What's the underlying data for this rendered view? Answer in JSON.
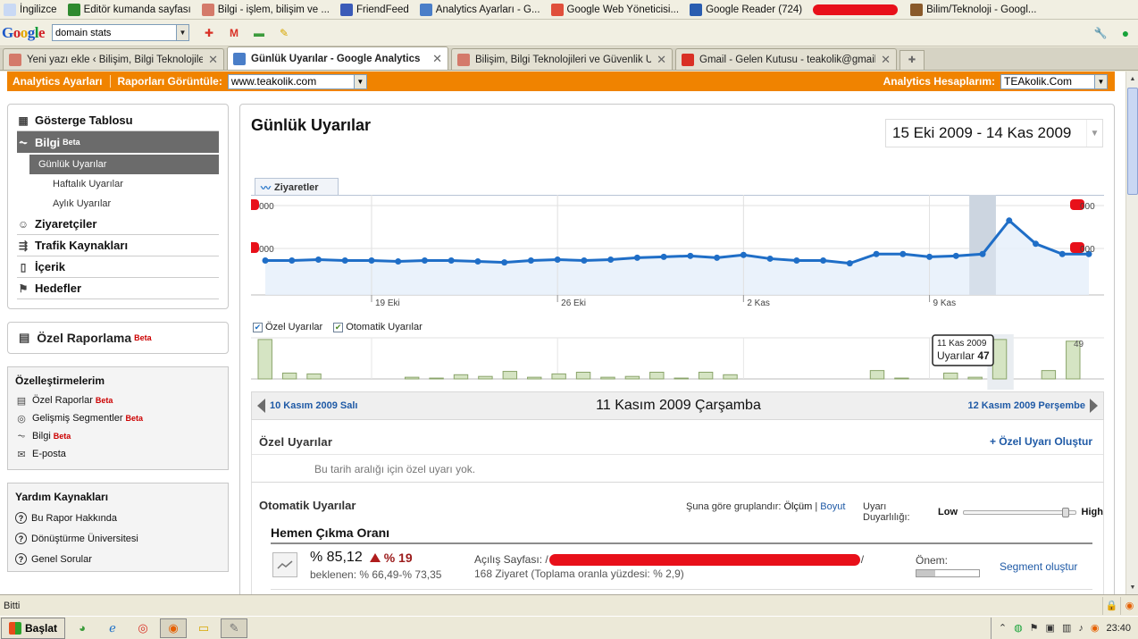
{
  "browser": {
    "bookmarks": [
      {
        "label": "İngilizce",
        "color": "#c9d9f4"
      },
      {
        "label": "Editör kumanda sayfası",
        "color": "#2f8a2f"
      },
      {
        "label": "Bilgi - işlem, bilişim ve ...",
        "color": "#d47a6a"
      },
      {
        "label": "FriendFeed",
        "color": "#3b5bb8"
      },
      {
        "label": "Analytics Ayarları - G...",
        "color": "#4a7ec8"
      },
      {
        "label": "Google Web Yöneticisi...",
        "color": "#e04f3b"
      },
      {
        "label": "Google Reader (724)",
        "color": "#2a5db0"
      },
      {
        "label": "Bilim/Teknoloji - Googl...",
        "color": "#8a5a2a"
      }
    ],
    "toolbar": {
      "logo": "Google",
      "search_value": "domain stats"
    },
    "tabs": [
      {
        "title": "Yeni yazı ekle ‹ Bilişim, Bilgi Teknolojileri ...",
        "active": false,
        "color": "#d47a6a"
      },
      {
        "title": "Günlük Uyarılar - Google Analytics",
        "active": true,
        "color": "#4a7ec8"
      },
      {
        "title": "Bilişim, Bilgi Teknolojileri ve Güvenlik Üz...",
        "active": false,
        "color": "#d47a6a"
      },
      {
        "title": "Gmail - Gelen Kutusu - teakolik@gmail.c...",
        "active": false,
        "color": "#d93025"
      }
    ],
    "status_text": "Bitti"
  },
  "ga": {
    "settings_link": "Analytics Ayarları",
    "view_reports_label": "Raporları Görüntüle:",
    "site_value": "www.teakolik.com",
    "accounts_label": "Analytics Hesaplarım:",
    "account_value": "TEAkolik.Com"
  },
  "nav": {
    "dashboard": "Gösterge Tablosu",
    "intel": "Bilgi",
    "beta": "Beta",
    "daily": "Günlük Uyarılar",
    "weekly": "Haftalık Uyarılar",
    "monthly": "Aylık Uyarılar",
    "visitors": "Ziyaretçiler",
    "traffic": "Trafik Kaynakları",
    "content": "İçerik",
    "goals": "Hedefler",
    "custom_reporting": "Özel Raporlama"
  },
  "customizations": {
    "title": "Özelleştirmelerim",
    "items": [
      "Özel Raporlar",
      "Gelişmiş Segmentler",
      "Bilgi",
      "E-posta"
    ],
    "beta_flags": [
      true,
      true,
      true,
      false
    ]
  },
  "help": {
    "title": "Yardım Kaynakları",
    "items": [
      "Bu Rapor Hakkında",
      "Dönüştürme Üniversitesi",
      "Genel Sorular"
    ]
  },
  "report": {
    "title": "Günlük Uyarılar",
    "date_range": "15 Eki 2009 - 14 Kas 2009",
    "chart_tab": "Ziyaretler",
    "legend_custom": "Özel Uyarılar",
    "legend_auto": "Otomatik Uyarılar",
    "tooltip_date": "11 Kas 2009",
    "tooltip_label": "Uyarılar",
    "tooltip_value": "47",
    "prev_day": "10 Kasım 2009 Salı",
    "current_day": "11 Kasım 2009 Çarşamba",
    "next_day": "12 Kasım 2009 Perşembe",
    "custom_alerts_header": "Özel Uyarılar",
    "create_custom_alert": "+ Özel Uyarı Oluştur",
    "no_custom_alerts": "Bu tarih aralığı için özel uyarı yok.",
    "auto_alerts_header": "Otomatik Uyarılar",
    "group_by_label": "Şuna göre gruplandır:",
    "group_metric": "Ölçüm",
    "group_sep": "|",
    "group_dimension": "Boyut",
    "sensitivity_label": "Uyarı Duyarlılığı:",
    "sensitivity_low": "Low",
    "sensitivity_high": "High",
    "sensitivity_level": 0.93,
    "alert": {
      "title": "Hemen Çıkma Oranı",
      "value": "% 85,12",
      "change": "% 19",
      "expected": "beklenen: % 66,49-% 73,35",
      "landing_label": "Açılış Sayfası: /",
      "landing_tail": "/",
      "visits": "168 Ziyaret (Toplama oranla yüzdesi: % 2,9)",
      "importance_label": "Önem:",
      "importance_level": 0.3,
      "segment_link": "Segment oluştur"
    }
  },
  "taskbar": {
    "start": "Başlat",
    "clock": "23:40"
  },
  "chart_data": [
    {
      "type": "line",
      "series": [
        {
          "name": "Ziyaretler",
          "values": [
            0.37,
            0.37,
            0.38,
            0.37,
            0.37,
            0.36,
            0.37,
            0.37,
            0.36,
            0.35,
            0.37,
            0.38,
            0.37,
            0.38,
            0.4,
            0.41,
            0.42,
            0.4,
            0.43,
            0.39,
            0.37,
            0.37,
            0.34,
            0.44,
            0.44,
            0.41,
            0.42,
            0.44,
            0.8,
            0.55,
            0.44,
            0.44
          ]
        }
      ],
      "x_tick_labels": [
        "19 Eki",
        "26 Eki",
        "2 Kas",
        "9 Kas"
      ],
      "y_tick_labels": [
        "000",
        "000"
      ],
      "highlight_index": 27,
      "grid": true,
      "colors": {
        "line": "#1f6ec7",
        "area": "#e6f0fa",
        "highlight": "#ccd6e0"
      }
    },
    {
      "type": "bar",
      "series": [
        {
          "name": "Otomatik Uyarılar",
          "values": [
            47,
            7,
            6,
            0,
            0,
            0,
            2,
            1,
            5,
            3,
            9,
            2,
            6,
            8,
            2,
            3,
            8,
            1,
            8,
            5,
            0,
            0,
            0,
            0,
            0,
            10,
            1,
            0,
            7,
            2,
            47,
            0,
            10,
            45
          ]
        }
      ],
      "y_tick_labels": [
        "49"
      ],
      "highlight_index": 27,
      "colors": {
        "bar": "#d5e4c3",
        "bar_border": "#8aa46a"
      }
    }
  ]
}
